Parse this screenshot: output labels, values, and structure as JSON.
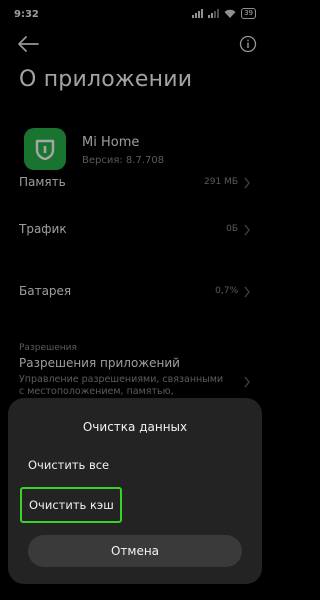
{
  "status_bar": {
    "time": "9:32",
    "battery": "39"
  },
  "header": {
    "title": "О приложении"
  },
  "app": {
    "name": "Mi Home",
    "version": "Версия: 8.7.708",
    "icon_color": "#27b24a"
  },
  "rows": [
    {
      "label": "Память",
      "value": "291 МБ"
    },
    {
      "label": "Трафик",
      "value": "0Б"
    },
    {
      "label": "Батарея",
      "value": "0,7%"
    }
  ],
  "permissions": {
    "caption": "Разрешения",
    "title": "Разрешения приложений",
    "description": "Управление разрешениями, связанными с местоположением, памятью, вызовами, ..."
  },
  "dialog": {
    "title": "Очистка данных",
    "options": [
      "Очистить все",
      "Очистить кэш"
    ],
    "cancel": "Отмена",
    "highlight_color": "#3ad12a"
  }
}
